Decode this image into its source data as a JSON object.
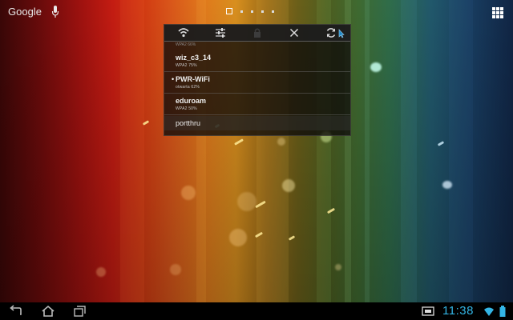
{
  "top_bar": {
    "search_label": "Google",
    "search_icon": "google-search",
    "voice_icon": "microphone-icon",
    "page_indicator": {
      "count": 5,
      "current": 1
    },
    "apps_icon": "apps-grid-icon"
  },
  "wifi_widget": {
    "toolbar": [
      {
        "name": "wifi-toggle-icon",
        "glyph": "wifi"
      },
      {
        "name": "settings-sliders-icon",
        "glyph": "sliders"
      },
      {
        "name": "lock-icon",
        "glyph": "lock"
      },
      {
        "name": "close-icon",
        "glyph": "x"
      },
      {
        "name": "refresh-icon",
        "glyph": "refresh"
      }
    ],
    "peek_text": "WPA2 66%",
    "networks": [
      {
        "name": "wiz_c3_14",
        "detail": "WPA2 75%",
        "connected": false
      },
      {
        "name": "PWR-WiFi",
        "detail": "otwarta 62%",
        "connected": true
      },
      {
        "name": "eduroam",
        "detail": "WPA2 50%",
        "connected": false
      },
      {
        "name": "portthru",
        "detail": "",
        "connected": false
      }
    ]
  },
  "nav_bar": {
    "back_icon": "back-icon",
    "home_icon": "home-icon",
    "recents_icon": "recent-apps-icon",
    "clock": "11:38",
    "notification_icon": "screenshot-notification-icon",
    "status_icons": [
      "wifi-signal-icon",
      "battery-icon"
    ]
  },
  "colors": {
    "accent": "#33b5e5",
    "panel_bg": "#0e0c0a"
  }
}
